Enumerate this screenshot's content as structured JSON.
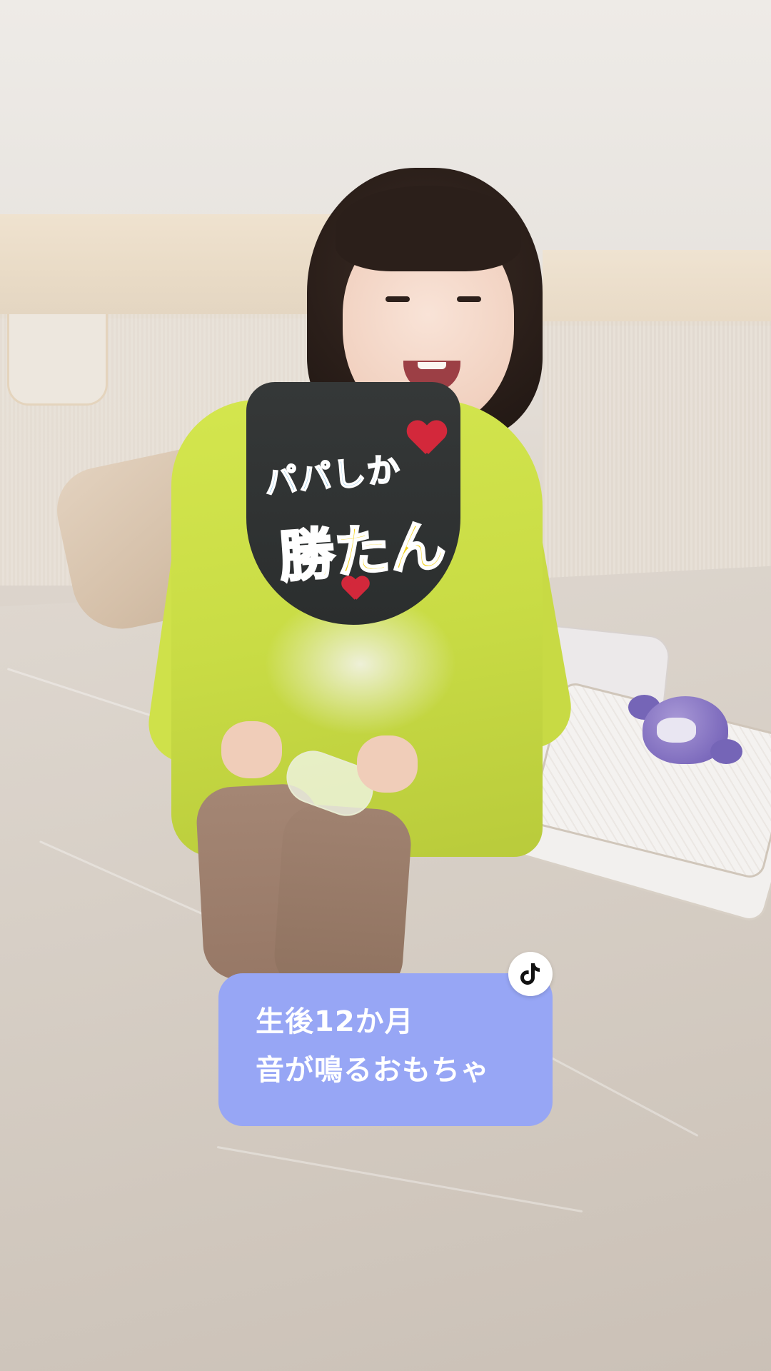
{
  "caption": {
    "line1": "生後12か月",
    "line2": "音が鳴るおもちゃ"
  },
  "badge": {
    "icon": "tiktok-logo-icon"
  },
  "bib": {
    "text_top": "パパしか",
    "text_main": "勝たん"
  },
  "colors": {
    "caption_bg": "#97a6f5",
    "caption_text": "#ffffff",
    "badge_bg": "#ffffff",
    "shirt": "#cfe14a",
    "bib": "#2f3232"
  }
}
